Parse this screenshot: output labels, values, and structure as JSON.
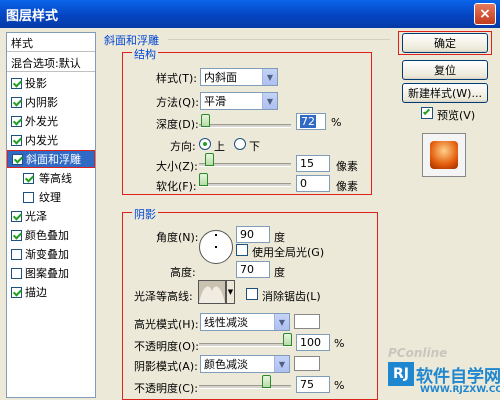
{
  "window": {
    "title": "图层样式",
    "close": "×"
  },
  "styles_panel": {
    "header": "样式",
    "blend": "混合选项:默认",
    "items": [
      {
        "label": "投影",
        "checked": true
      },
      {
        "label": "内阴影",
        "checked": true
      },
      {
        "label": "外发光",
        "checked": true
      },
      {
        "label": "内发光",
        "checked": true
      },
      {
        "label": "斜面和浮雕",
        "checked": true
      },
      {
        "label": "等高线",
        "checked": true
      },
      {
        "label": "纹理",
        "checked": false
      },
      {
        "label": "光泽",
        "checked": true
      },
      {
        "label": "颜色叠加",
        "checked": true
      },
      {
        "label": "渐变叠加",
        "checked": false
      },
      {
        "label": "图案叠加",
        "checked": false
      },
      {
        "label": "描边",
        "checked": true
      }
    ]
  },
  "bevel": {
    "section_title": "斜面和浮雕",
    "structure_title": "结构",
    "style_label": "样式(T):",
    "style_value": "内斜面",
    "technique_label": "方法(Q):",
    "technique_value": "平滑",
    "depth_label": "深度(D):",
    "depth_value": "72",
    "depth_unit": "%",
    "direction_label": "方向:",
    "direction_up": "上",
    "direction_down": "下",
    "size_label": "大小(Z):",
    "size_value": "15",
    "size_unit": "像素",
    "soften_label": "软化(F):",
    "soften_value": "0",
    "soften_unit": "像素"
  },
  "shading": {
    "title": "阴影",
    "angle_label": "角度(N):",
    "angle_value": "90",
    "angle_unit": "度",
    "global_light": "使用全局光(G)",
    "altitude_label": "高度:",
    "altitude_value": "70",
    "altitude_unit": "度",
    "gloss_label": "光泽等高线:",
    "antialias": "消除锯齿(L)",
    "highlight_label": "高光模式(H):",
    "highlight_value": "线性减淡",
    "highlight_opacity_label": "不透明度(O):",
    "highlight_opacity_value": "100",
    "shadow_label": "阴影模式(A):",
    "shadow_value": "颜色减淡",
    "shadow_opacity_label": "不透明度(C):",
    "shadow_opacity_value": "75",
    "percent": "%"
  },
  "buttons": {
    "ok": "确定",
    "reset": "复位",
    "new_style": "新建样式(W)...",
    "preview": "预览(V)"
  },
  "watermark": {
    "pconline": "PConline",
    "brand": "软件自学网",
    "domain": "WWW.RJZXW.COM"
  },
  "colors": {
    "accent": "#316ac5",
    "highlight_box": "#e0201b",
    "preview_fill": "#e35d0b"
  }
}
